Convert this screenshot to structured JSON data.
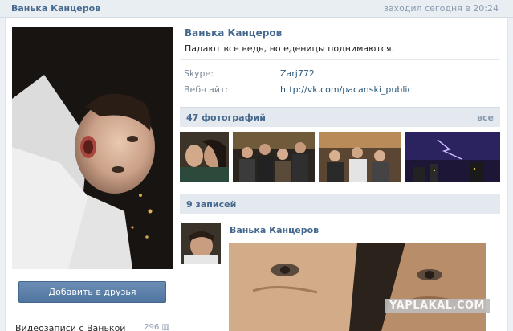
{
  "header": {
    "name": "Ванька Канцеров",
    "last_seen": "заходил сегодня в 20:24"
  },
  "profile": {
    "name": "Ванька Канцеров",
    "status": "Падают все ведь, но еденицы поднимаются.",
    "info": [
      {
        "label": "Skype:",
        "value": "Zarj772"
      },
      {
        "label": "Веб-сайт:",
        "value": "http://vk.com/pacanski_public"
      }
    ]
  },
  "sidebar": {
    "add_friend_label": "Добавить в друзья",
    "videos_label": "Видеозаписи с Ванькой",
    "videos_count": "296"
  },
  "photos": {
    "title": "47 фотографий",
    "all_label": "все"
  },
  "wall": {
    "title": "9 записей",
    "post_author": "Ванька Канцеров"
  },
  "watermark": "YAPLAKAL.COM",
  "colors": {
    "link_blue": "#45688e",
    "header_bg": "#e4e9ef",
    "button_blue": "#5b7fa8"
  }
}
